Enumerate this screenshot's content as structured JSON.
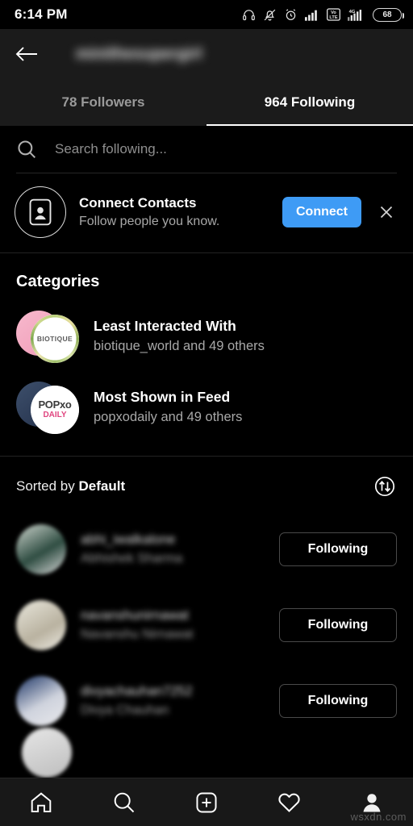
{
  "status_bar": {
    "time": "6:14 PM",
    "battery_percent": "68",
    "icons": [
      "headphones-icon",
      "notifications-muted-icon",
      "alarm-icon",
      "signal-bars-icon",
      "volte-icon",
      "signal-4g-icon",
      "battery-icon"
    ],
    "volte_label_top": "Vo",
    "volte_label_bottom": "LTE",
    "network_label": "4G"
  },
  "header": {
    "back_icon": "back-arrow-icon",
    "username": "minithesupergirl",
    "tabs": [
      {
        "label": "78 Followers",
        "active": false
      },
      {
        "label": "964 Following",
        "active": true
      }
    ]
  },
  "search": {
    "icon": "search-icon",
    "placeholder": "Search following..."
  },
  "connect_contacts": {
    "icon": "contact-card-icon",
    "title": "Connect Contacts",
    "subtitle": "Follow people you know.",
    "button_label": "Connect",
    "button_color": "#3e9bf5",
    "dismiss_icon": "close-icon"
  },
  "categories": {
    "heading": "Categories",
    "items": [
      {
        "title": "Least Interacted With",
        "subtitle": "biotique_world and 49 others",
        "avatar_label": "BIOTIQUE",
        "avatar_back_color": "#f2a8c0"
      },
      {
        "title": "Most Shown in Feed",
        "subtitle": "popxodaily and 49 others",
        "avatar_label_top": "POPxo",
        "avatar_label_bottom": "DAILY",
        "avatar_back_color": "#2b3a55"
      }
    ]
  },
  "sort": {
    "prefix": "Sorted by",
    "value": "Default",
    "icon": "sort-arrows-icon"
  },
  "user_list": {
    "follow_button_label": "Following",
    "rows": [
      {
        "username": "abhi_iwalkalone",
        "fullname": "Abhishek Sharma",
        "button": "Following"
      },
      {
        "username": "navanshunirnawat",
        "fullname": "Navanshu Nirnawat",
        "button": "Following"
      },
      {
        "username": "divyachauhan7252",
        "fullname": "Divya Chauhan",
        "button": "Following"
      }
    ]
  },
  "bottom_nav": {
    "items": [
      {
        "icon": "home-icon",
        "active": false
      },
      {
        "icon": "search-icon",
        "active": false
      },
      {
        "icon": "add-post-icon",
        "active": false
      },
      {
        "icon": "heart-icon",
        "active": false
      },
      {
        "icon": "profile-icon",
        "active": true
      }
    ]
  },
  "watermark": {
    "text": "wsxdn.com"
  }
}
